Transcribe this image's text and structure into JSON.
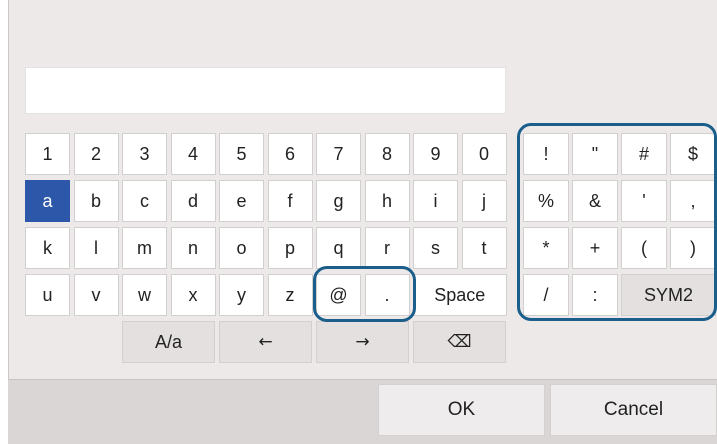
{
  "keyboard": {
    "rows": [
      [
        "1",
        "2",
        "3",
        "4",
        "5",
        "6",
        "7",
        "8",
        "9",
        "0"
      ],
      [
        "a",
        "b",
        "c",
        "d",
        "e",
        "f",
        "g",
        "h",
        "i",
        "j"
      ],
      [
        "k",
        "l",
        "m",
        "n",
        "o",
        "p",
        "q",
        "r",
        "s",
        "t"
      ],
      [
        "u",
        "v",
        "w",
        "x",
        "y",
        "z",
        "@",
        "."
      ]
    ],
    "space_label": "Space",
    "selected_key": "a",
    "bottom": {
      "case_toggle_label": "A/a",
      "left_arrow": "←",
      "right_arrow": "→",
      "backspace": "⌫"
    }
  },
  "symbols": {
    "rows": [
      [
        "!",
        "\"",
        "#",
        "$"
      ],
      [
        "%",
        "&",
        "'",
        ","
      ],
      [
        "*",
        "+",
        "(",
        ")"
      ],
      [
        "/",
        ":"
      ]
    ],
    "sym2_label": "SYM2"
  },
  "dialog": {
    "ok_label": "OK",
    "cancel_label": "Cancel"
  },
  "colors": {
    "selected_key": "#2d57a9",
    "highlight_ring": "#1b5e8c",
    "panel_bg": "#ece9e8"
  }
}
